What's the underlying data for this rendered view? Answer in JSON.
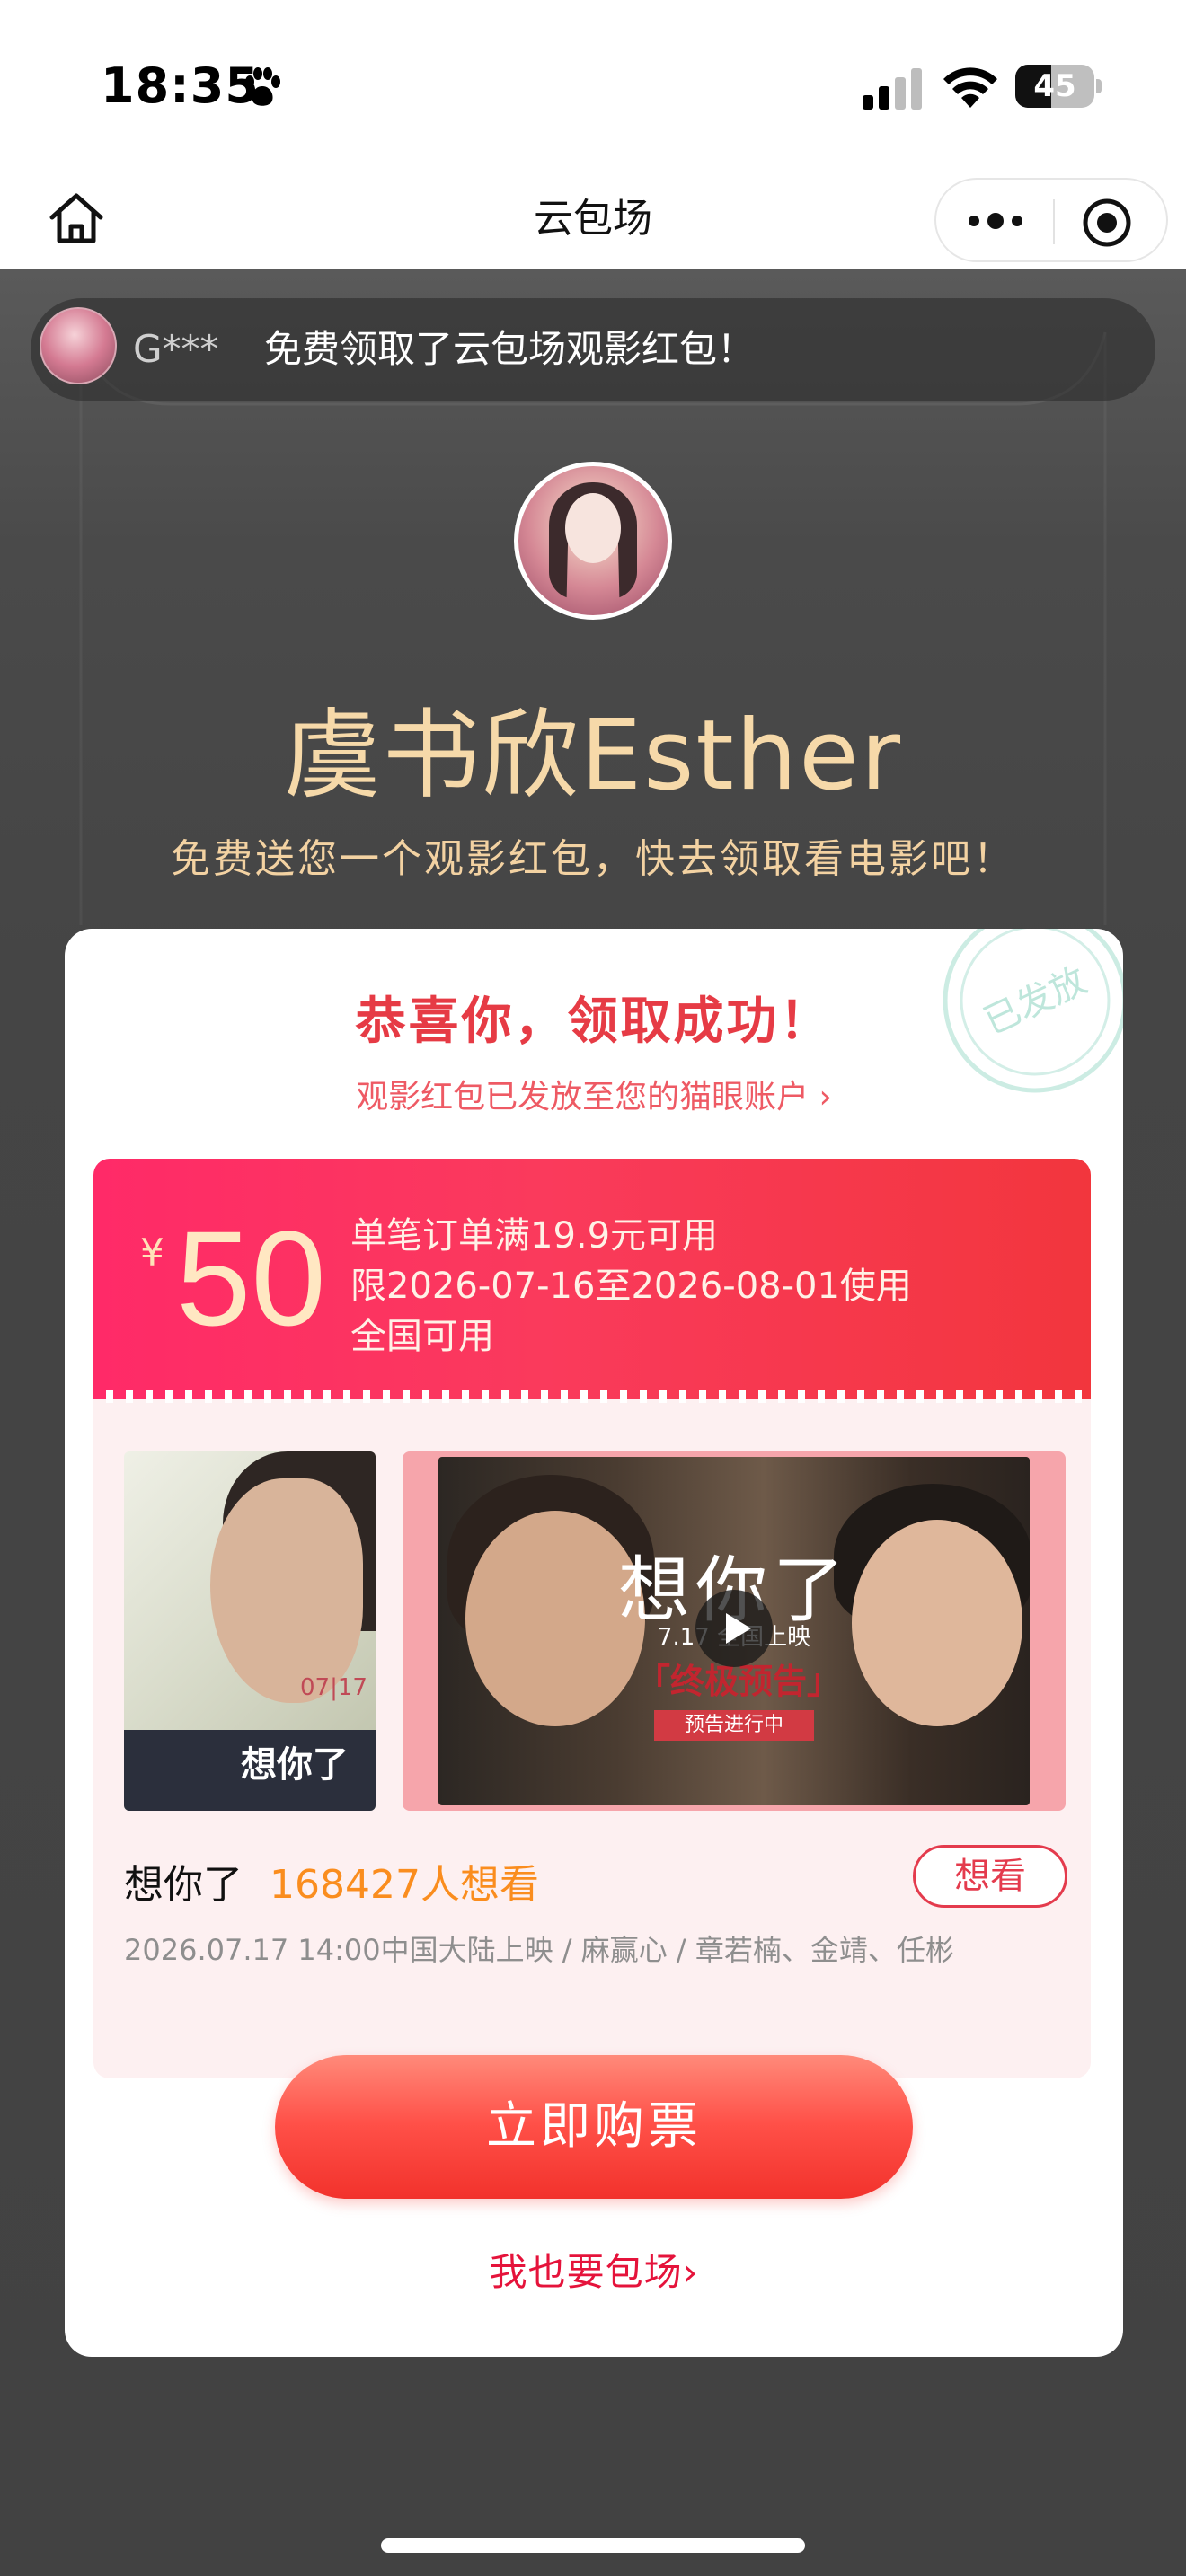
{
  "status_bar": {
    "time": "18:35",
    "battery": "45",
    "battery_level": 0.45
  },
  "nav": {
    "title": "云包场",
    "icons": [
      "home-icon",
      "more-icon",
      "target-icon"
    ]
  },
  "ticker": {
    "user": "G***",
    "text": "免费领取了云包场观影红包！"
  },
  "host": {
    "name": "虞书欣Esther",
    "subtitle": "免费送您一个观影红包，快去领取看电影吧！"
  },
  "card": {
    "title": "恭喜你，领取成功！",
    "subtitle": "观影红包已发放至您的猫眼账户 ›",
    "stamp_text": "已发放",
    "coupon": {
      "currency": "¥",
      "amount": "50",
      "lines": [
        "单笔订单满19.9元可用",
        "限2026-07-16至2026-08-01使用",
        "全国可用"
      ]
    },
    "poster": {
      "date": "07|17",
      "title": "想你了"
    },
    "trailer": {
      "title": "想你了",
      "date": "7.17 全国上映",
      "badge": "「终极预告」",
      "status": "预告进行中"
    },
    "movie": {
      "name": "想你了",
      "want_count": "168427人想看",
      "want_button": "想看",
      "meta": "2026.07.17 14:00中国大陆上映 / 麻赢心 / 章若楠、金靖、任彬"
    },
    "buy_button": "立即购票",
    "also_link": "我也要包场›"
  },
  "colors": {
    "accent_red": "#e63b45",
    "coupon_gradient_start": "#ff2a68",
    "coupon_gradient_end": "#f2363d",
    "gold_text": "#f6d9a9",
    "want_orange": "#fa8d1e"
  }
}
